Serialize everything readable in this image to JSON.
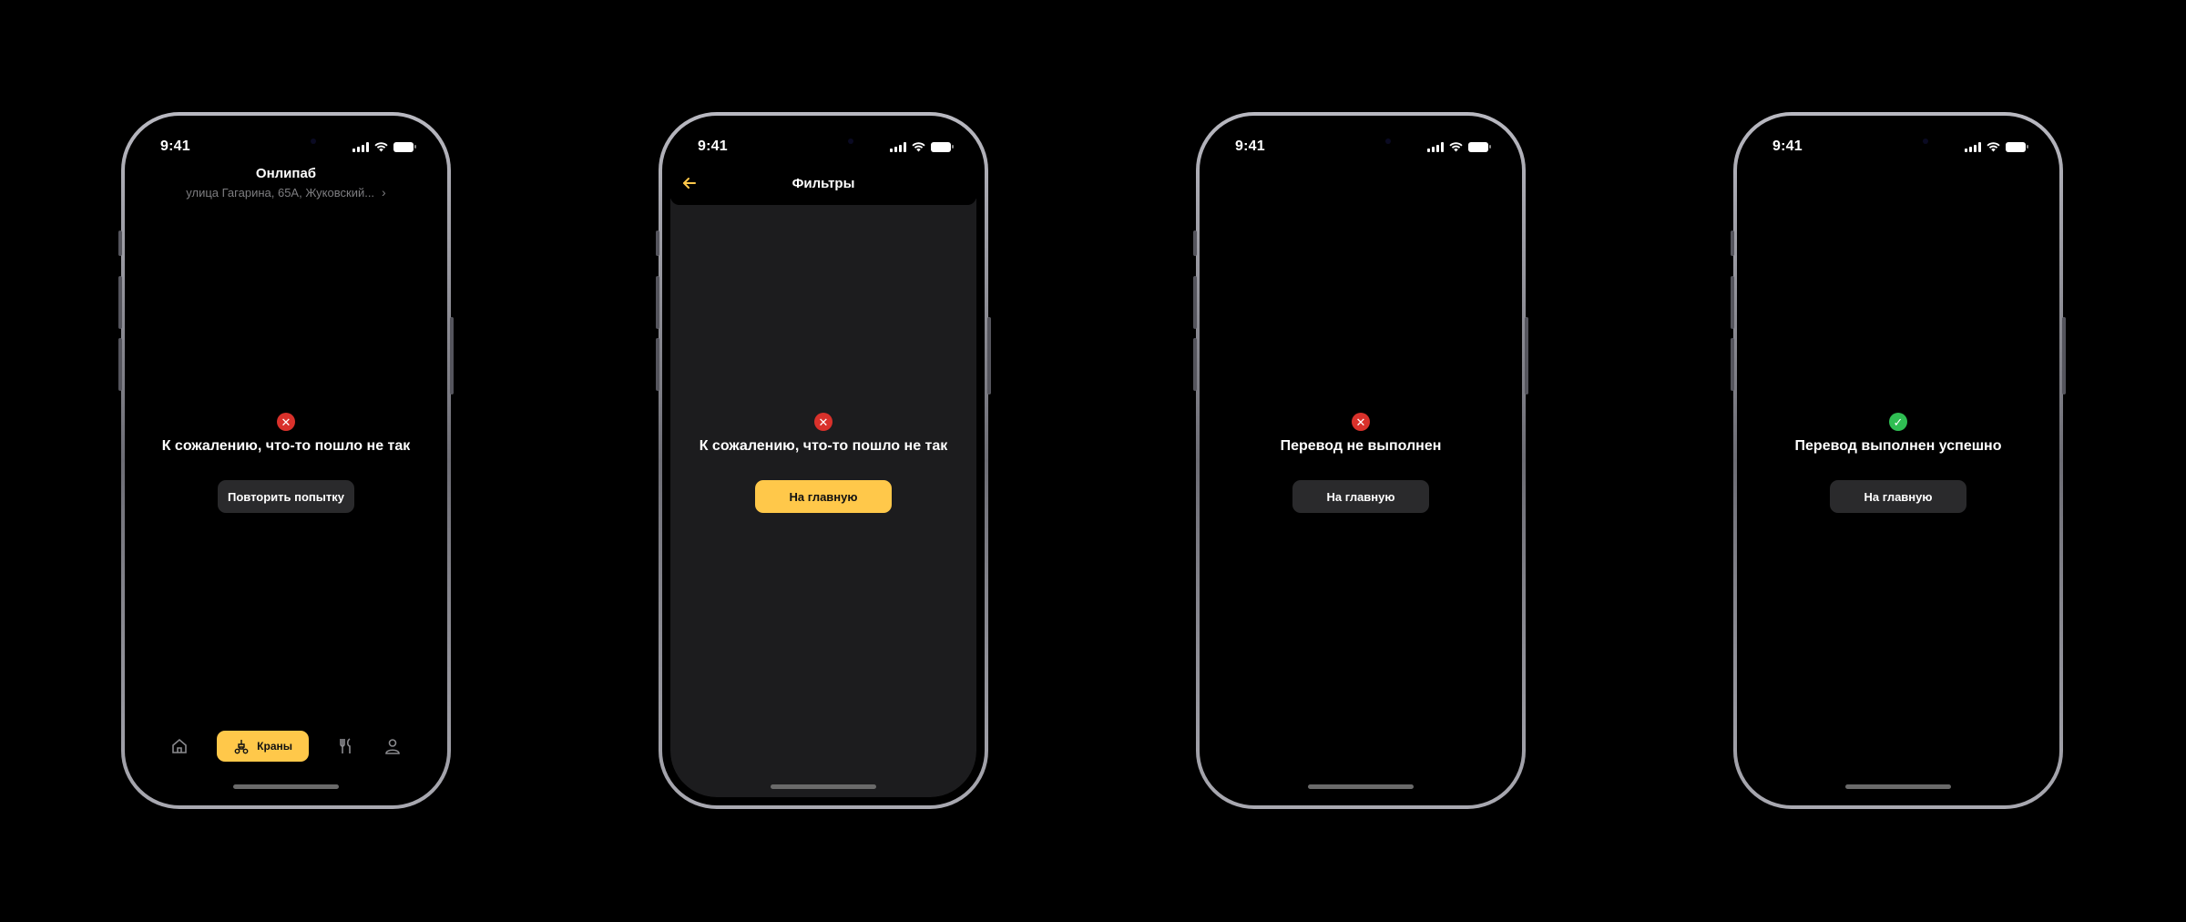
{
  "status_bar": {
    "time": "9:41"
  },
  "phone1": {
    "header": {
      "title": "Онлипаб",
      "address": "улица Гагарина, 65А, Жуковский..."
    },
    "message": "К сожалению, что-то пошло не так",
    "button": "Повторить попытку",
    "tabbar": {
      "active_label": "Краны",
      "icons": [
        "home-icon",
        "tap-icon",
        "fork-knife-icon",
        "profile-icon"
      ]
    }
  },
  "phone2": {
    "header": {
      "title": "Фильтры"
    },
    "message": "К сожалению, что-то пошло не так",
    "button": "На главную"
  },
  "phone3": {
    "message": "Перевод не выполнен",
    "button": "На главную"
  },
  "phone4": {
    "message": "Перевод выполнен успешно",
    "button": "На главную"
  },
  "glyphs": {
    "error": "✕",
    "success": "✓"
  },
  "colors": {
    "accent": "#ffc84a",
    "error": "#d9312b",
    "success": "#2fbe53",
    "secondary_button": "#2a2a2c",
    "sheet": "#1c1c1e"
  }
}
